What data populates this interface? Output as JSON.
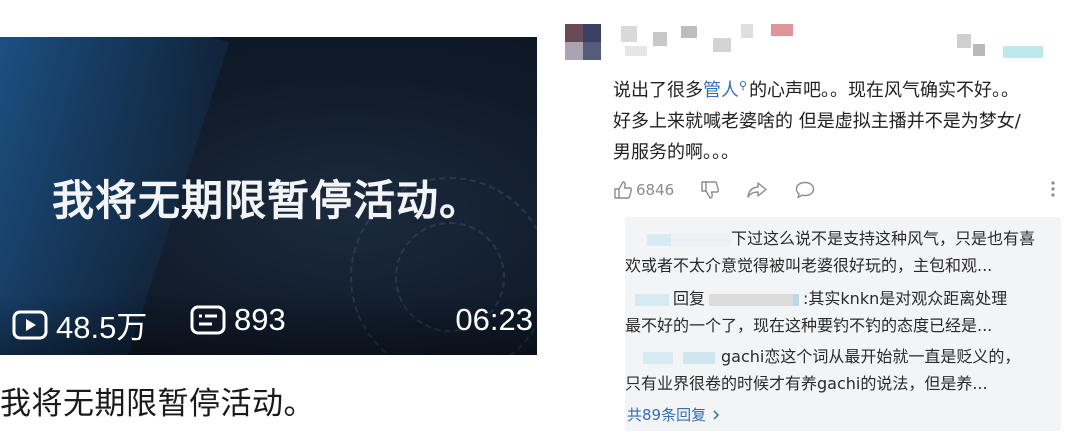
{
  "video": {
    "thumbnail_text": "我将无期限暂停活动。",
    "views": "48.5万",
    "comments": "893",
    "duration": "06:23",
    "title": "我将无期限暂停活动。"
  },
  "comment": {
    "text_before": "说出了很多",
    "link": "管人",
    "text_after": "的心声吧。。现在风气确实不好。。好多上来就喊老婆啥的 但是虚拟主播并不是为梦女/男服务的啊。。。",
    "likes": "6846",
    "replies": [
      {
        "prefix": "",
        "text_line1": "下过这么说不是支持这种风气，只是也有喜",
        "text_line2": "欢或者不太介意觉得被叫老婆很好玩的，主包和观..."
      },
      {
        "prefix": "回复",
        "text_line1": ":其实knkn是对观众距离处理",
        "text_line2": "最不好的一个了，现在这种要钓不钓的态度已经是..."
      },
      {
        "prefix": "",
        "text_line1": "gachi恋这个词从最开始就一直是贬义的，",
        "text_line2": "只有业界很卷的时候才有养gachi的说法，但是养..."
      }
    ],
    "reply_count_label": "共89条回复",
    "colors": {
      "link": "#2f6fb5",
      "muted": "#8c8c8c",
      "reply_bg": "#f3f4f6"
    }
  },
  "icons": [
    "play-count-icon",
    "danmaku-icon",
    "like-icon",
    "dislike-icon",
    "share-icon",
    "reply-icon",
    "more-icon",
    "search-mark-icon",
    "chevron-right-icon"
  ]
}
